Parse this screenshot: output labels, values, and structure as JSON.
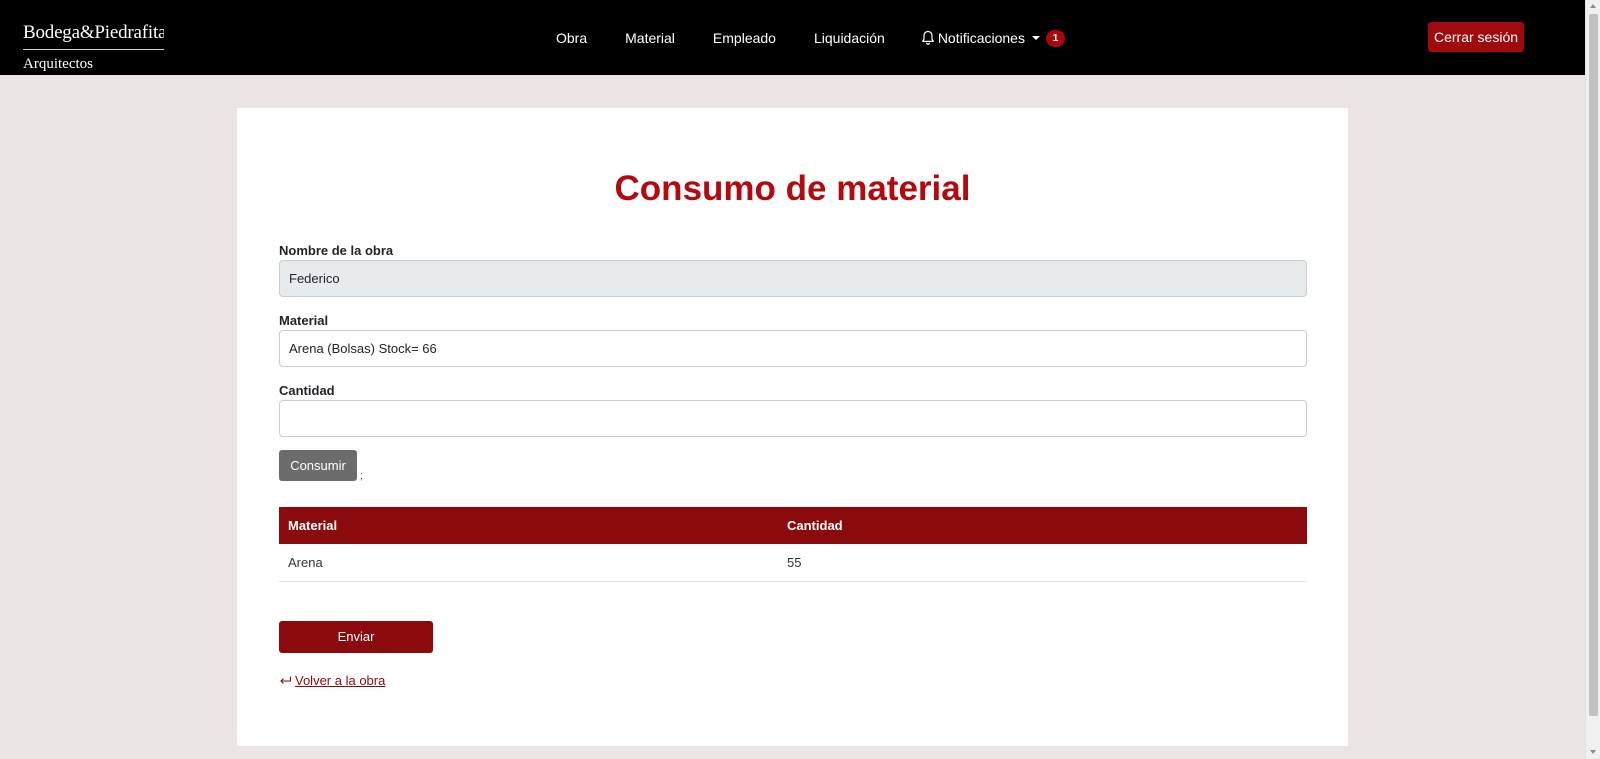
{
  "brand": {
    "name": "Bodega&Piedrafita",
    "subtitle": "Arquitectos"
  },
  "nav": {
    "items": [
      {
        "label": "Obra"
      },
      {
        "label": "Material"
      },
      {
        "label": "Empleado"
      },
      {
        "label": "Liquidación"
      }
    ],
    "notifications": {
      "label": "Notificaciones",
      "count": "1",
      "icon": "bell-icon"
    },
    "logout_label": "Cerrar sesión"
  },
  "page": {
    "title": "Consumo de material"
  },
  "form": {
    "obra_label": "Nombre de la obra",
    "obra_value": "Federico",
    "material_label": "Material",
    "material_value": "Arena (Bolsas) Stock= 66",
    "cantidad_label": "Cantidad",
    "cantidad_value": "",
    "consume_label": "Consumir",
    "stray_text": ";"
  },
  "table": {
    "headers": [
      "Material",
      "Cantidad"
    ],
    "rows": [
      [
        "Arena",
        "55"
      ]
    ]
  },
  "actions": {
    "submit_label": "Enviar",
    "back_label": " Volver a la obra",
    "back_icon": "return-arrow-icon"
  },
  "colors": {
    "brand_red": "#b30a0f",
    "dark_red": "#8a0a0e",
    "navbar": "#000000",
    "page_bg": "#ebe4e4"
  }
}
